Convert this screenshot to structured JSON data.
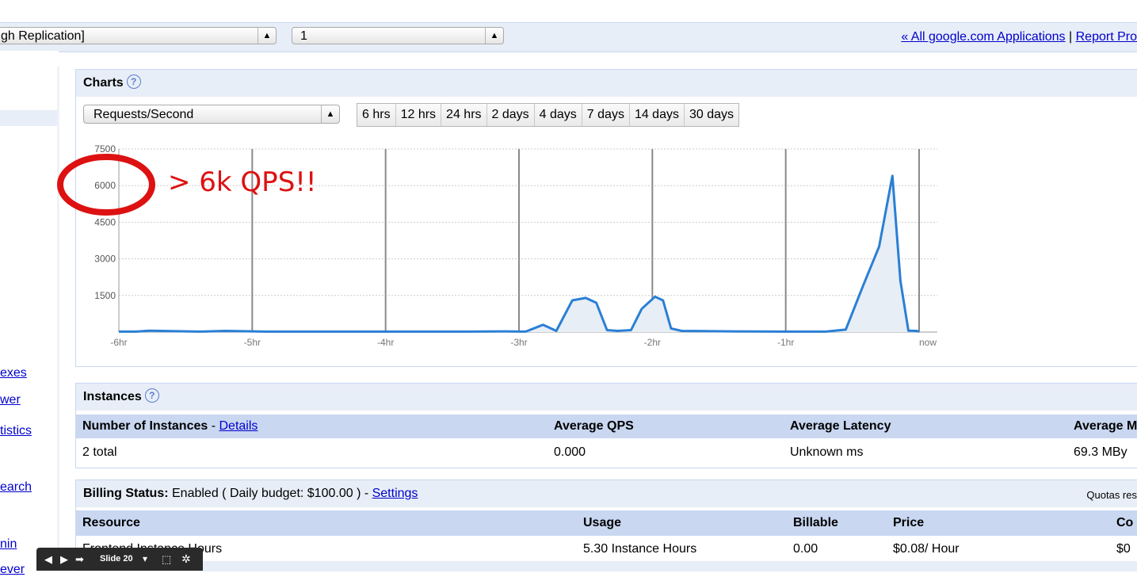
{
  "app_bar": {
    "app_select_value": "gh Replication]",
    "version_select_value": "1",
    "all_apps_link": "« All google.com Applications",
    "separator": "|",
    "report_link": "Report Pro"
  },
  "sidebar": {
    "links": [
      "exes",
      "wer",
      "tistics",
      "earch",
      "nin",
      "ever"
    ]
  },
  "charts": {
    "title": "Charts",
    "help_glyph": "?",
    "metric_select_value": "Requests/Second",
    "time_ranges": [
      "6 hrs",
      "12 hrs",
      "24 hrs",
      "2 days",
      "4 days",
      "7 days",
      "14 days",
      "30 days"
    ],
    "annotation": "> 6k QPS!!",
    "accent_color": "#2a7fd4",
    "annotation_color": "#dd1111"
  },
  "chart_data": {
    "type": "area",
    "x_labels": [
      "-6hr",
      "-5hr",
      "-4hr",
      "-3hr",
      "-2hr",
      "-1hr",
      "now"
    ],
    "y_ticks": [
      "1500",
      "3000",
      "4500",
      "6000",
      "7500"
    ],
    "ylim": [
      0,
      7500
    ],
    "xlim": [
      -6,
      0
    ],
    "grid": true,
    "x": [
      -6.0,
      -5.87,
      -5.77,
      -5.4,
      -5.2,
      -4.9,
      -3.4,
      -3.1,
      -2.95,
      -2.82,
      -2.72,
      -2.6,
      -2.5,
      -2.42,
      -2.34,
      -2.26,
      -2.16,
      -2.08,
      -1.98,
      -1.92,
      -1.86,
      -1.78,
      -1.4,
      -1.0,
      -0.7,
      -0.55,
      -0.42,
      -0.3,
      -0.2,
      -0.14,
      -0.08,
      -0.02,
      0.0
    ],
    "y": [
      20,
      20,
      60,
      20,
      50,
      20,
      20,
      30,
      20,
      300,
      50,
      1300,
      1400,
      1200,
      80,
      50,
      80,
      950,
      1450,
      1300,
      150,
      50,
      30,
      20,
      20,
      100,
      1900,
      3500,
      6400,
      2100,
      60,
      50,
      20
    ]
  },
  "instances": {
    "title": "Instances",
    "help_glyph": "?",
    "headers": {
      "count_label": "Number of Instances",
      "dash": " - ",
      "details_link": "Details",
      "qps": "Average QPS",
      "latency": "Average Latency",
      "memory": "Average M"
    },
    "row": {
      "count": "2 total",
      "qps": "0.000",
      "latency": "Unknown ms",
      "memory": "69.3 MBy"
    }
  },
  "billing": {
    "label": "Billing Status:",
    "status": " Enabled ( Daily budget: $100.00 ) - ",
    "settings_link": "Settings",
    "quotas_note": "Quotas res",
    "headers": {
      "resource": "Resource",
      "usage": "Usage",
      "billable": "Billable",
      "price": "Price",
      "cost": "Co"
    },
    "row": {
      "resource": "Frontend Instance Hours",
      "usage": "5.30 Instance Hours",
      "billable": "0.00",
      "price": "$0.08/ Hour",
      "cost": "$0"
    }
  },
  "slide_controls": {
    "prev": "◀",
    "play": "▶",
    "next": "➡",
    "slide_label": "Slide 20",
    "dropdown": "▾",
    "screen": "⬚",
    "settings": "✲"
  }
}
